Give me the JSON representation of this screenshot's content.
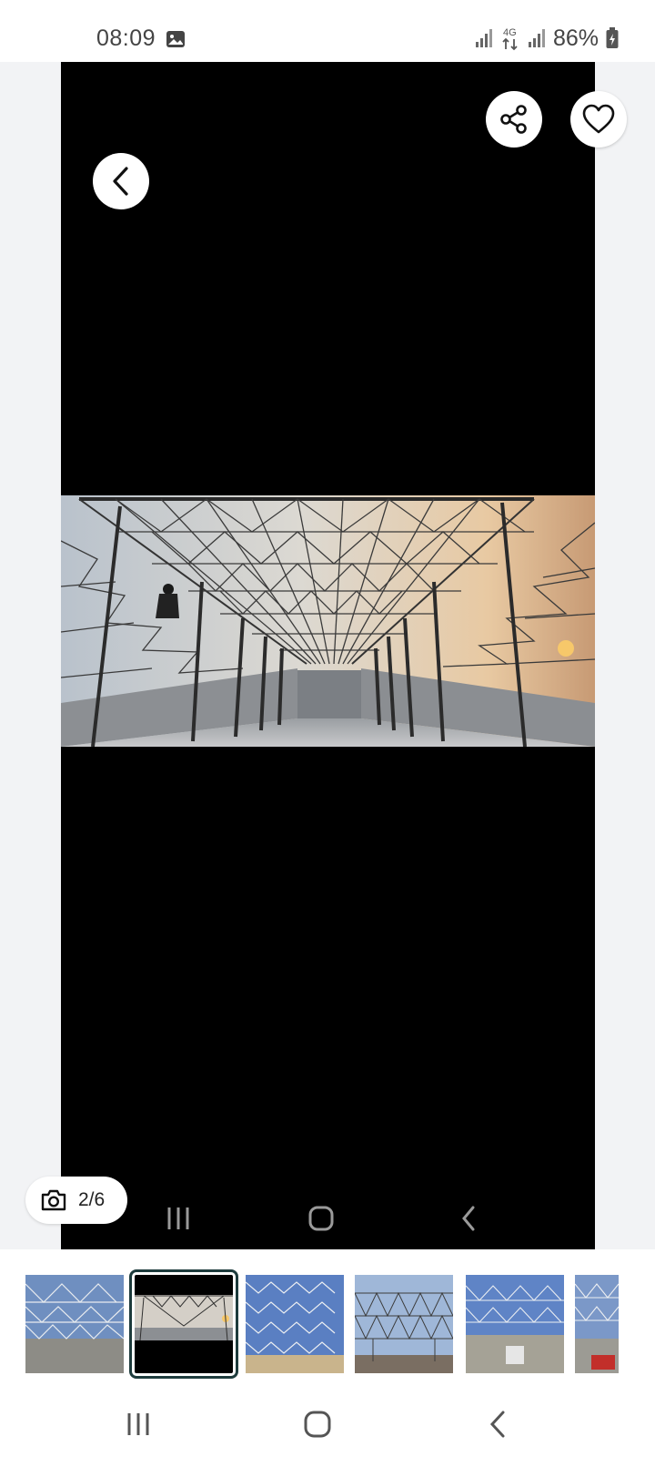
{
  "status_bar": {
    "time": "08:09",
    "battery": "86%",
    "network": "4G",
    "icons": [
      "gallery-icon",
      "signal-icon",
      "data-icon",
      "signal-icon",
      "battery-icon"
    ]
  },
  "viewer": {
    "photo_alt": "steel roof truss structure",
    "actions": {
      "back_icon": "chevron-left-icon",
      "share_icon": "share-icon",
      "favorite_icon": "heart-icon"
    },
    "counter": {
      "icon": "camera-icon",
      "text": "2/6"
    }
  },
  "thumbnails": {
    "count": 6,
    "selected": 2
  },
  "nav": {
    "recents_icon": "recents-icon",
    "home_icon": "home-icon",
    "back_icon": "back-icon"
  },
  "colors": {
    "viewer_bg": "#000000",
    "page_bg": "#f2f3f5",
    "selected_outline": "#1d3b3c"
  }
}
